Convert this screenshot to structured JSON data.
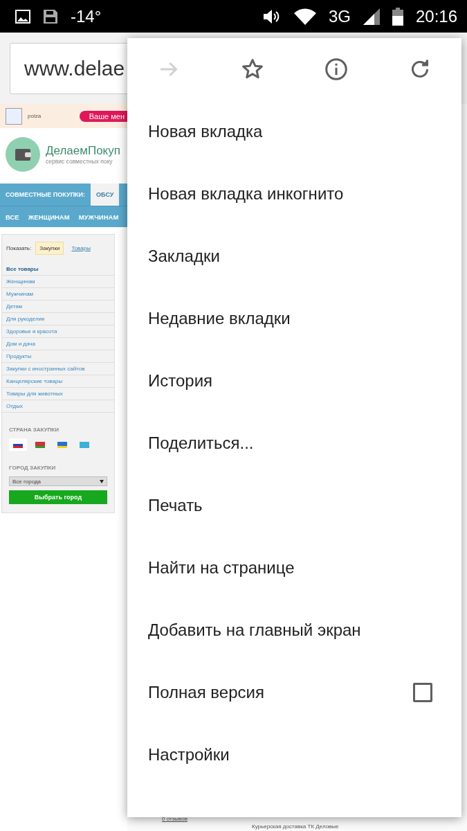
{
  "status_bar": {
    "temperature": "-14°",
    "network": "3G",
    "time": "20:16"
  },
  "toolbar": {
    "url": "www.delae"
  },
  "page": {
    "notice": {
      "text": "polza",
      "button": "Ваше мен"
    },
    "logo": {
      "title": "ДелаемПокуп",
      "subtitle": "сервис совместных поку"
    },
    "nav_tabs": [
      {
        "label": "СОВМЕСТНЫЕ ПОКУПКИ:",
        "selected": true
      },
      {
        "label": "ОБСУ",
        "selected": false
      }
    ],
    "nav_links": [
      "ВСЕ",
      "ЖЕНЩИНАМ",
      "МУЖЧИНАМ"
    ],
    "sidebar": {
      "show_label": "Показать:",
      "show_options": [
        {
          "label": "Закупки",
          "selected": true
        },
        {
          "label": "Товары",
          "selected": false
        }
      ],
      "categories": [
        {
          "label": "Все товары",
          "selected": true
        },
        {
          "label": "Женщинам",
          "selected": false
        },
        {
          "label": "Мужчинам",
          "selected": false
        },
        {
          "label": "Детям",
          "selected": false
        },
        {
          "label": "Для рукоделия",
          "selected": false
        },
        {
          "label": "Здоровье и красота",
          "selected": false
        },
        {
          "label": "Дом и дача",
          "selected": false
        },
        {
          "label": "Продукты",
          "selected": false
        },
        {
          "label": "Закупки с иностранных сайтов",
          "selected": false
        },
        {
          "label": "Канцелярские товары",
          "selected": false
        },
        {
          "label": "Товары для животных",
          "selected": false
        },
        {
          "label": "Отдых",
          "selected": false
        }
      ],
      "country_label": "СТРАНА ЗАКУПКИ",
      "countries": [
        {
          "kind": "ru",
          "selected": true
        },
        {
          "kind": "by",
          "selected": false
        },
        {
          "kind": "ua",
          "selected": false
        },
        {
          "kind": "kz",
          "selected": false
        }
      ],
      "city_label": "ГОРОД ЗАКУПКИ",
      "city_value": "Все города",
      "city_button": "Выбрать город"
    },
    "bottom": {
      "reviews": "0 отзывов",
      "delivery": "Курьерская доставка ТК Деловые"
    }
  },
  "menu": {
    "icons": [
      {
        "kind": "forward",
        "disabled": true
      },
      {
        "kind": "star",
        "disabled": false
      },
      {
        "kind": "info",
        "disabled": false
      },
      {
        "kind": "reload",
        "disabled": false
      }
    ],
    "items": [
      {
        "label": "Новая вкладка",
        "kind": "plain"
      },
      {
        "label": "Новая вкладка инкогнито",
        "kind": "plain"
      },
      {
        "label": "Закладки",
        "kind": "plain"
      },
      {
        "label": "Недавние вкладки",
        "kind": "plain"
      },
      {
        "label": "История",
        "kind": "plain"
      },
      {
        "label": "Поделиться...",
        "kind": "plain"
      },
      {
        "label": "Печать",
        "kind": "plain"
      },
      {
        "label": "Найти на странице",
        "kind": "plain"
      },
      {
        "label": "Добавить на главный экран",
        "kind": "plain"
      },
      {
        "label": "Полная версия",
        "kind": "checkbox",
        "checked": false
      },
      {
        "label": "Настройки",
        "kind": "plain"
      }
    ]
  }
}
